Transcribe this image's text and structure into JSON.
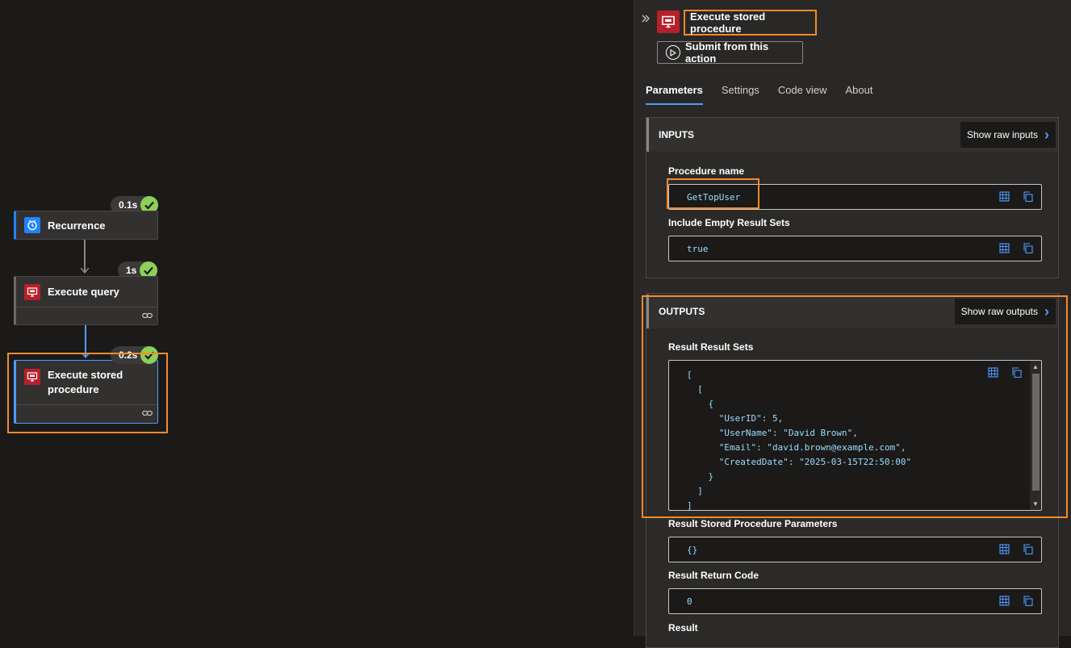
{
  "canvas": {
    "nodes": [
      {
        "label": "Recurrence",
        "duration": "0.1s"
      },
      {
        "label": "Execute query",
        "duration": "1s"
      },
      {
        "label": "Execute stored procedure",
        "duration": "0.2s"
      }
    ]
  },
  "panel": {
    "title": "Execute stored procedure",
    "submit_label": "Submit from this action",
    "tabs": [
      "Parameters",
      "Settings",
      "Code view",
      "About"
    ],
    "inputs": {
      "header": "INPUTS",
      "raw_button": "Show raw inputs",
      "fields": [
        {
          "label": "Procedure name",
          "value": "GetTopUser"
        },
        {
          "label": "Include Empty Result Sets",
          "value": "true"
        }
      ]
    },
    "outputs": {
      "header": "OUTPUTS",
      "raw_button": "Show raw outputs",
      "result_sets_label": "Result Result Sets",
      "result_sets_code": "[\n  [\n    {\n      \"UserID\": 5,\n      \"UserName\": \"David Brown\",\n      \"Email\": \"david.brown@example.com\",\n      \"CreatedDate\": \"2025-03-15T22:50:00\"\n    }\n  ]\n]",
      "fields": [
        {
          "label": "Result Stored Procedure Parameters",
          "value": "{}"
        },
        {
          "label": "Result Return Code",
          "value": "0"
        }
      ],
      "last_label": "Result"
    }
  },
  "colors": {
    "accent": "#4f9bff",
    "highlight": "#f28a2e",
    "success": "#8ccf5a",
    "sql_red": "#b7202b",
    "trigger_blue": "#1f85ff"
  },
  "icons": [
    "clock-icon",
    "sql-monitor-icon",
    "link-icon",
    "check-icon",
    "play-circle-icon",
    "chevron-right-icon",
    "double-chevron-right-icon",
    "expand-icon",
    "copy-icon"
  ]
}
